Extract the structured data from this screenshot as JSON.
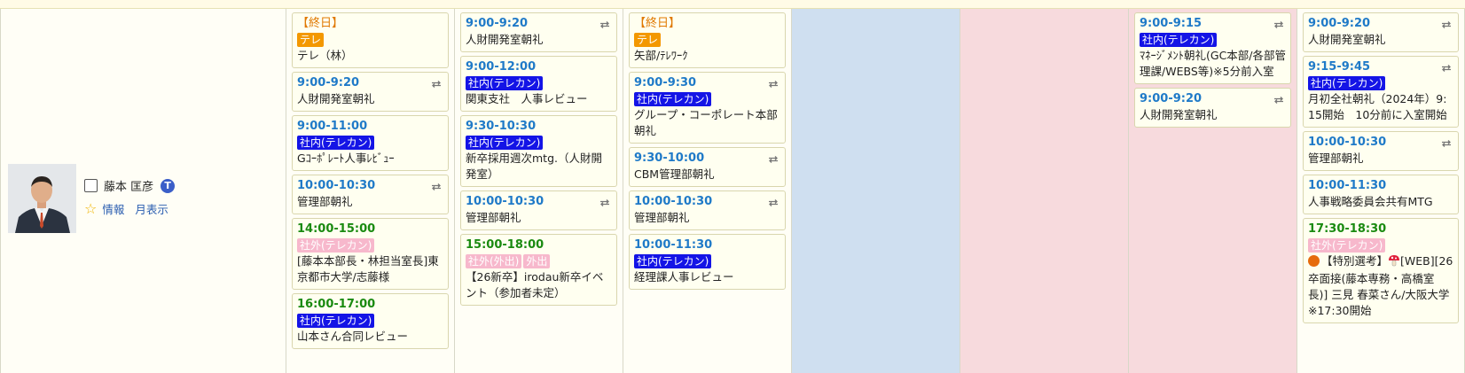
{
  "person": {
    "name": "藤本 匡彦",
    "badge": "T",
    "info_link": "情報",
    "month_link": "月表示"
  },
  "colors": {
    "tag_orange": "#f39800",
    "tag_blue": "#1414e6",
    "tag_pink": "#f7b8cc",
    "time_blue": "#1f7ac8",
    "time_green": "#1a8a10",
    "saturday_bg": "#cfdff0",
    "holiday_bg": "#f7dadd"
  },
  "days": [
    {
      "events": [
        {
          "time": "【終日】",
          "time_color": "allday",
          "tags": [
            {
              "label": "テレ",
              "color": "orange"
            }
          ],
          "title": "テレ（林）",
          "repeat": false
        },
        {
          "time": "9:00-9:20",
          "time_color": "blue",
          "tags": [],
          "title": "人財開発室朝礼",
          "repeat": true
        },
        {
          "time": "9:00-11:00",
          "time_color": "blue",
          "tags": [
            {
              "label": "社内(テレカン)",
              "color": "blue"
            }
          ],
          "title": "Gｺｰﾎﾟﾚｰﾄ人事ﾚﾋﾞｭｰ",
          "repeat": false
        },
        {
          "time": "10:00-10:30",
          "time_color": "blue",
          "tags": [],
          "title": "管理部朝礼",
          "repeat": true
        },
        {
          "time": "14:00-15:00",
          "time_color": "green",
          "tags": [
            {
              "label": "社外(テレカン)",
              "color": "pink"
            }
          ],
          "title": "[藤本本部長・林担当室長]東京都市大学/志藤様",
          "repeat": false
        },
        {
          "time": "16:00-17:00",
          "time_color": "green",
          "tags": [
            {
              "label": "社内(テレカン)",
              "color": "blue"
            }
          ],
          "title": "山本さん合同レビュー",
          "repeat": false
        }
      ]
    },
    {
      "events": [
        {
          "time": "9:00-9:20",
          "time_color": "blue",
          "tags": [],
          "title": "人財開発室朝礼",
          "repeat": true
        },
        {
          "time": "9:00-12:00",
          "time_color": "blue",
          "tags": [
            {
              "label": "社内(テレカン)",
              "color": "blue"
            }
          ],
          "title": "関東支社　人事レビュー",
          "repeat": false
        },
        {
          "time": "9:30-10:30",
          "time_color": "blue",
          "tags": [
            {
              "label": "社内(テレカン)",
              "color": "blue"
            }
          ],
          "title": "新卒採用週次mtg.（人財開発室）",
          "repeat": false
        },
        {
          "time": "10:00-10:30",
          "time_color": "blue",
          "tags": [],
          "title": "管理部朝礼",
          "repeat": true
        },
        {
          "time": "15:00-18:00",
          "time_color": "green",
          "tags": [
            {
              "label": "社外(外出)",
              "color": "pink"
            },
            {
              "label": "外出",
              "color": "pink"
            }
          ],
          "title": "【26新卒】irodau新卒イベント（参加者未定）",
          "repeat": false
        }
      ]
    },
    {
      "events": [
        {
          "time": "【終日】",
          "time_color": "allday",
          "tags": [
            {
              "label": "テレ",
              "color": "orange"
            }
          ],
          "title": "矢部/ﾃﾚﾜｰｸ",
          "repeat": false
        },
        {
          "time": "9:00-9:30",
          "time_color": "blue",
          "tags": [
            {
              "label": "社内(テレカン)",
              "color": "blue"
            }
          ],
          "title": "グループ・コーポレート本部　朝礼",
          "repeat": true
        },
        {
          "time": "9:30-10:00",
          "time_color": "blue",
          "tags": [],
          "title": "CBM管理部朝礼",
          "repeat": true
        },
        {
          "time": "10:00-10:30",
          "time_color": "blue",
          "tags": [],
          "title": "管理部朝礼",
          "repeat": true
        },
        {
          "time": "10:00-11:30",
          "time_color": "blue",
          "tags": [
            {
              "label": "社内(テレカン)",
              "color": "blue"
            }
          ],
          "title": "経理課人事レビュー",
          "repeat": false
        }
      ]
    },
    {
      "events": []
    },
    {
      "events": []
    },
    {
      "events": [
        {
          "time": "9:00-9:15",
          "time_color": "blue",
          "tags": [
            {
              "label": "社内(テレカン)",
              "color": "blue"
            }
          ],
          "title": "ﾏﾈｰｼﾞﾒﾝﾄ朝礼(GC本部/各部管理課/WEBS等)※5分前入室",
          "repeat": true
        },
        {
          "time": "9:00-9:20",
          "time_color": "blue",
          "tags": [],
          "title": "人財開発室朝礼",
          "repeat": true
        }
      ]
    },
    {
      "events": [
        {
          "time": "9:00-9:20",
          "time_color": "blue",
          "tags": [],
          "title": "人財開発室朝礼",
          "repeat": true
        },
        {
          "time": "9:15-9:45",
          "time_color": "blue",
          "tags": [
            {
              "label": "社内(テレカン)",
              "color": "blue"
            }
          ],
          "title": "月初全社朝礼（2024年）9:15開始　10分前に入室開始",
          "repeat": true
        },
        {
          "time": "10:00-10:30",
          "time_color": "blue",
          "tags": [],
          "title": "管理部朝礼",
          "repeat": true
        },
        {
          "time": "10:00-11:30",
          "time_color": "blue",
          "tags": [],
          "title": "人事戦略委員会共有MTG",
          "repeat": false
        },
        {
          "time": "17:30-18:30",
          "time_color": "green",
          "tags": [
            {
              "label": "社外(テレカン)",
              "color": "pink"
            }
          ],
          "title_prefix": "【特別選考】",
          "title": "[WEB][26卒面接(藤本専務・高橋室長)] 三見 春菜さん/大阪大学　※17:30開始",
          "icons": [
            "orange-circle-icon",
            "mushroom-icon"
          ],
          "repeat": false
        }
      ]
    }
  ]
}
